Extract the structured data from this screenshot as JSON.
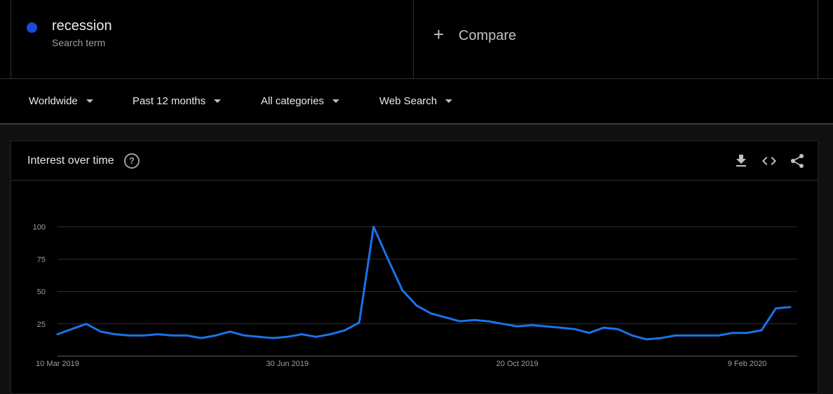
{
  "search_term": {
    "name": "recession",
    "type": "Search term",
    "color": "#1a4bd6"
  },
  "compare": {
    "label": "Compare"
  },
  "filters": [
    {
      "label": "Worldwide"
    },
    {
      "label": "Past 12 months"
    },
    {
      "label": "All categories"
    },
    {
      "label": "Web Search"
    }
  ],
  "card": {
    "title": "Interest over time",
    "actions": [
      "download-icon",
      "embed-icon",
      "share-icon"
    ]
  },
  "chart_data": {
    "type": "line",
    "title": "Interest over time",
    "xlabel": "",
    "ylabel": "",
    "ylim": [
      0,
      100
    ],
    "yticks": [
      25,
      50,
      75,
      100
    ],
    "x_tick_labels": [
      {
        "label": "10 Mar 2019",
        "week": 0
      },
      {
        "label": "30 Jun 2019",
        "week": 16
      },
      {
        "label": "20 Oct 2019",
        "week": 32
      },
      {
        "label": "9 Feb 2020",
        "week": 48
      }
    ],
    "grid": true,
    "color": "#1a73e8",
    "series": [
      {
        "values": [
          17,
          21,
          25,
          19,
          17,
          16,
          16,
          17,
          16,
          16,
          14,
          16,
          19,
          16,
          15,
          14,
          15,
          17,
          15,
          17,
          20,
          26,
          100,
          75,
          51,
          39,
          33,
          30,
          27,
          28,
          27,
          25,
          23,
          24,
          23,
          22,
          21,
          18,
          22,
          21,
          16,
          13,
          14,
          16,
          16,
          16,
          16,
          18,
          18,
          20,
          37,
          38
        ]
      }
    ]
  }
}
